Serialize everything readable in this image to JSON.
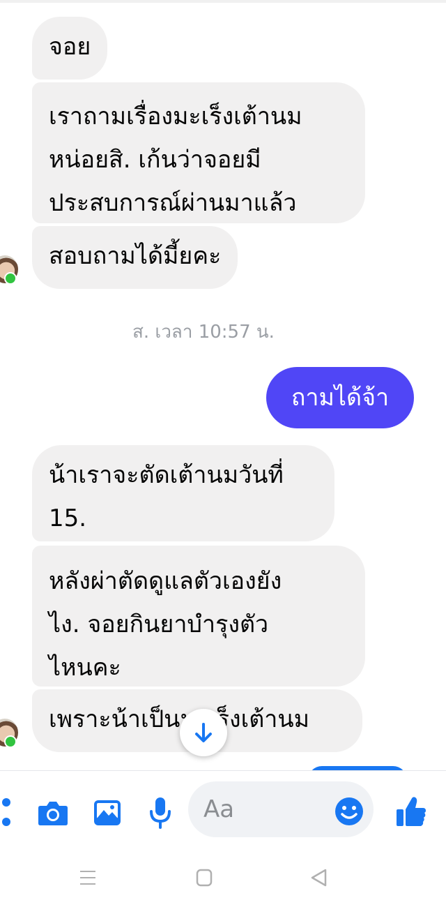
{
  "thread": {
    "incoming_1": {
      "m1": "จอย",
      "m2": "เราถามเรื่องมะเร็งเต้านม\nหน่อยสิ. เก้นว่าจอยมี\nประสบการณ์ผ่านมาแล้ว",
      "m3": "สอบถามได้มี้ยคะ"
    },
    "timestamp": "ส. เวลา 10:57 น.",
    "outgoing": {
      "m1": "ถามได้จ้า"
    },
    "incoming_2": {
      "m1": "น้าเราจะตัดเต้านมวันที่\n15.",
      "m2": "หลังผ่าตัดดูแลตัวเองยัง\nไง. จอยกินยาบำรุงตัว\nไหนคะ",
      "m3": "เพราะน้าเป็นมะเร็งเต้านม"
    }
  },
  "icons": {
    "more": "more-dots-icon",
    "camera": "camera-icon",
    "gallery": "image-icon",
    "mic": "microphone-icon",
    "emoji": "emoji-icon",
    "like": "thumbs-up-icon",
    "scroll": "arrow-down-icon"
  },
  "composer": {
    "placeholder": "Aa"
  },
  "colors": {
    "accent": "#1877f2",
    "outgoing_bubble": "#5046f6",
    "incoming_bubble": "#f1f0f0",
    "online": "#31c440"
  }
}
